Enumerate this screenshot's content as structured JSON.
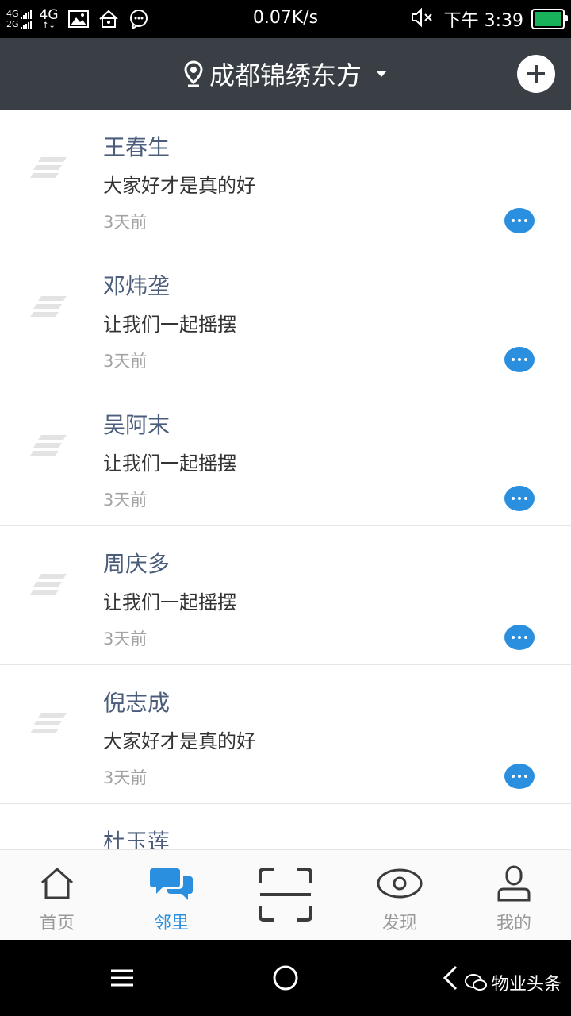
{
  "status_bar": {
    "sim1": "4G",
    "sim2": "2G",
    "network": "4G",
    "speed": "0.07K/s",
    "time": "下午 3:39"
  },
  "header": {
    "location": "成都锦绣东方"
  },
  "posts": [
    {
      "name": "王春生",
      "message": "大家好才是真的好",
      "time": "3天前"
    },
    {
      "name": "邓炜垄",
      "message": "让我们一起摇摆",
      "time": "3天前"
    },
    {
      "name": "吴阿末",
      "message": "让我们一起摇摆",
      "time": "3天前"
    },
    {
      "name": "周庆多",
      "message": "让我们一起摇摆",
      "time": "3天前"
    },
    {
      "name": "倪志成",
      "message": "大家好才是真的好",
      "time": "3天前"
    },
    {
      "name": "杜玉莲"
    }
  ],
  "tabs": [
    {
      "label": "首页",
      "icon": "home-icon"
    },
    {
      "label": "邻里",
      "icon": "chat-bubbles-icon",
      "active": true
    },
    {
      "label": "",
      "icon": "scan-icon"
    },
    {
      "label": "发现",
      "icon": "eye-icon"
    },
    {
      "label": "我的",
      "icon": "user-icon"
    }
  ],
  "watermark": "物业头条",
  "colors": {
    "header_bg": "#3a3f45",
    "accent": "#2b8fe0",
    "name_text": "#4b5d7a",
    "battery": "#17b25a"
  }
}
